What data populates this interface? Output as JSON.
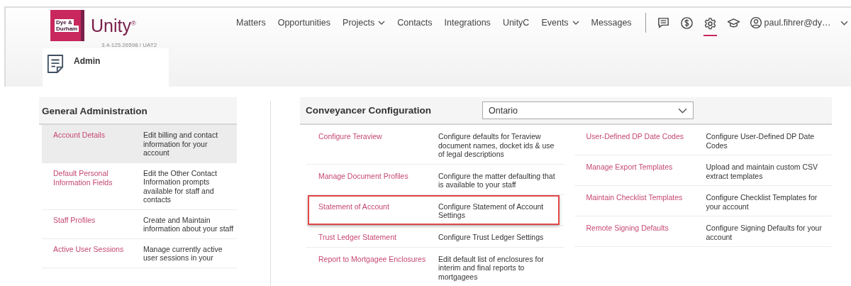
{
  "brand": {
    "logo_lines": [
      "Dye &",
      "Durham"
    ],
    "name": "Unity",
    "mark": "®",
    "version": "3.4-125.26598 / UAT2"
  },
  "nav": [
    {
      "label": "Matters",
      "dropdown": false
    },
    {
      "label": "Opportunities",
      "dropdown": false
    },
    {
      "label": "Projects",
      "dropdown": true
    },
    {
      "label": "Contacts",
      "dropdown": false
    },
    {
      "label": "Integrations",
      "dropdown": false
    },
    {
      "label": "UnityC",
      "dropdown": false
    },
    {
      "label": "Events",
      "dropdown": true
    },
    {
      "label": "Messages",
      "dropdown": false
    }
  ],
  "toolbar": [
    {
      "kind": "chat",
      "selected": false
    },
    {
      "kind": "dollar",
      "selected": false
    },
    {
      "kind": "gear",
      "selected": true
    },
    {
      "kind": "cap",
      "selected": false
    }
  ],
  "user": {
    "label": "paul.fihrer@dy…"
  },
  "page_tab": {
    "label": "Admin"
  },
  "general": {
    "title": "General Administration",
    "items": [
      {
        "name": "Account Details",
        "description": "Edit billing and contact information for your account",
        "highlighted": true
      },
      {
        "name": "Default Personal Information Fields",
        "description": "Edit the Other Contact Information prompts available for staff and contacts",
        "highlighted": false
      },
      {
        "name": "Staff Profiles",
        "description": "Create and Maintain information about your staff",
        "highlighted": false
      },
      {
        "name": "Active User Sessions",
        "description": "Manage currently active user sessions in your",
        "highlighted": false
      }
    ]
  },
  "conveyancer": {
    "title": "Conveyancer Configuration",
    "province": "Ontario",
    "columns": [
      [
        {
          "name": "Configure Teraview",
          "description": "Configure defaults for Teraview document names, docket ids & use of legal descriptions",
          "outlined": false
        },
        {
          "name": "Manage Document Profiles",
          "description": "Configure the matter defaulting that is available to your staff",
          "outlined": false
        },
        {
          "name": "Statement of Account",
          "description": "Configure Statement of Account Settings",
          "outlined": true
        },
        {
          "name": "Trust Ledger Statement",
          "description": "Configure Trust Ledger Settings",
          "outlined": false
        },
        {
          "name": "Report to Mortgagee Enclosures",
          "description": "Edit default list of enclosures for interim and final reports to mortgagees",
          "outlined": false
        }
      ],
      [
        {
          "name": "User-Defined DP Date Codes",
          "description": "Configure User-Defined DP Date Codes",
          "outlined": false
        },
        {
          "name": "Manage Export Templates",
          "description": "Upload and maintain custom CSV extract templates",
          "outlined": false
        },
        {
          "name": "Maintain Checklist Templates",
          "description": "Configure Checklist Templates for your account",
          "outlined": false
        },
        {
          "name": "Remote Signing Defaults",
          "description": "Configure Signing Defaults for your account",
          "outlined": false
        }
      ]
    ]
  }
}
